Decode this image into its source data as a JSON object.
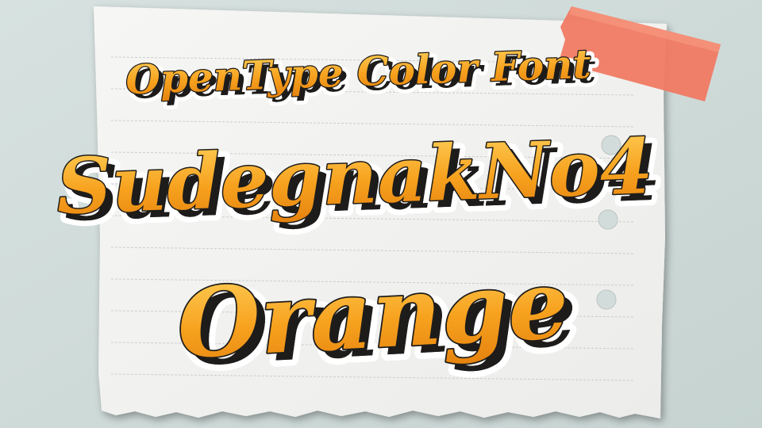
{
  "colors": {
    "background": "#cfdbd9",
    "paper": "#f2f2f0",
    "rule_line": "#c9cccd",
    "tape": "#f07a63",
    "letter_fill": "#f29a1f",
    "letter_highlight": "#ffd166",
    "letter_outline": "#1e1c1a",
    "letter_halo": "#ffffff"
  },
  "headline": {
    "line1": "OpenType Color Font",
    "line2": "SudegnakNo4",
    "line3": "Orange"
  },
  "decorations": {
    "tape": "masking-tape",
    "punch_holes": 3
  }
}
